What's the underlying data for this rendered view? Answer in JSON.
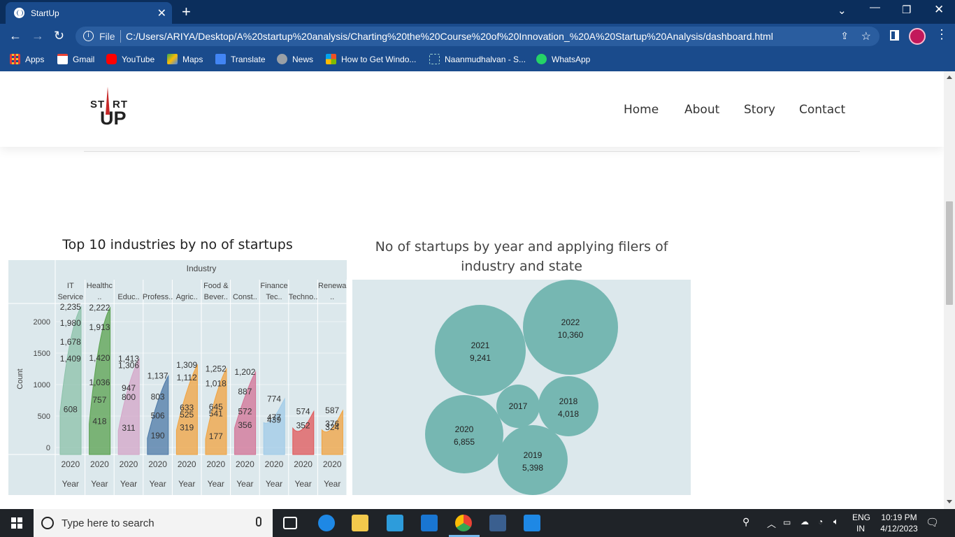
{
  "browser": {
    "tab_title": "StartUp",
    "tab_close": "✕",
    "new_tab": "+",
    "url_scheme": "File",
    "url": "C:/Users/ARIYA/Desktop/A%20startup%20analysis/Charting%20the%20Course%20of%20Innovation_%20A%20Startup%20Analysis/dashboard.html",
    "bookmarks": [
      "Apps",
      "Gmail",
      "YouTube",
      "Maps",
      "Translate",
      "News",
      "How to Get Windo...",
      "Naanmudhalvan - S...",
      "WhatsApp"
    ]
  },
  "nav": {
    "logo_text_left": "ST",
    "logo_text_right": "RT",
    "logo_text_bottom": "UP",
    "links": [
      "Home",
      "About",
      "Story",
      "Contact"
    ]
  },
  "colors": {
    "browser_bg": "#1a4b8c",
    "viz_bg": "#dce8ec",
    "bubble": "#76b7b2"
  },
  "industry_viz": {
    "title": "Top 10 industries by no of startups",
    "column_header": "Industry",
    "y_axis_label": "Count",
    "x_axis_label": "Year",
    "x_tick": "2020",
    "y_ticks": [
      "2000",
      "1500",
      "1000",
      "500",
      "0"
    ],
    "industries": [
      {
        "label1": "IT",
        "label2": "Service",
        "color": "#8cc2aa",
        "values": [
          "2,235",
          "1,980",
          "1,678",
          "1,409",
          "608"
        ]
      },
      {
        "label1": "Healthc",
        "label2": "..",
        "color": "#59a14f",
        "values": [
          "2,222",
          "1,913",
          "1,420",
          "1,036",
          "757",
          "418"
        ]
      },
      {
        "label1": "",
        "label2": "Educ..",
        "color": "#d4a6c8",
        "values": [
          "1,413",
          "1,306",
          "947",
          "800",
          "311"
        ]
      },
      {
        "label1": "",
        "label2": "Profess..",
        "color": "#4e79a7",
        "values": [
          "1,137",
          "803",
          "506",
          "190"
        ]
      },
      {
        "label1": "",
        "label2": "Agric..",
        "color": "#f1a340",
        "values": [
          "1,309",
          "1,112",
          "633",
          "525",
          "319"
        ]
      },
      {
        "label1": "Food &",
        "label2": "Bever..",
        "color": "#f1a340",
        "values": [
          "1,252",
          "1,018",
          "645",
          "541",
          "177"
        ]
      },
      {
        "label1": "",
        "label2": "Const..",
        "color": "#d37295",
        "values": [
          "1,202",
          "887",
          "572",
          "356"
        ]
      },
      {
        "label1": "Finance",
        "label2": "Tec..",
        "color": "#a0cbe8",
        "values": [
          "774",
          "477",
          "439"
        ]
      },
      {
        "label1": "",
        "label2": "Techno..",
        "color": "#e15759",
        "values": [
          "574",
          "352"
        ]
      },
      {
        "label1": "Renewa",
        "label2": "..",
        "color": "#f1a340",
        "values": [
          "587",
          "376",
          "324"
        ]
      }
    ]
  },
  "bubble_viz": {
    "title_line1": "No of startups by year  and applying filers of",
    "title_line2": "industry and state",
    "bubbles": [
      {
        "year": "2022",
        "count": "10,360"
      },
      {
        "year": "2021",
        "count": "9,241"
      },
      {
        "year": "2020",
        "count": "6,855"
      },
      {
        "year": "2019",
        "count": "5,398"
      },
      {
        "year": "2018",
        "count": "4,018"
      },
      {
        "year": "2017",
        "count": ""
      }
    ]
  },
  "taskbar": {
    "search_placeholder": "Type here to search",
    "lang1": "ENG",
    "lang2": "IN",
    "time": "10:19 PM",
    "date": "4/12/2023"
  }
}
